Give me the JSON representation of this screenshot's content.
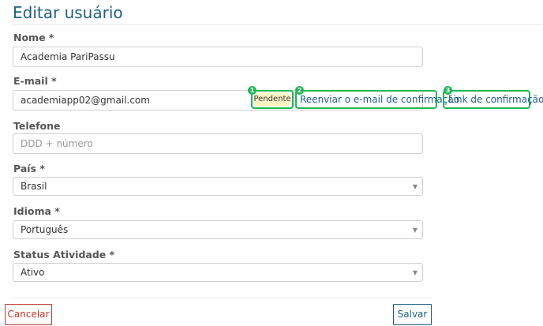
{
  "page": {
    "title": "Editar usuário"
  },
  "form": {
    "name": {
      "label": "Nome *",
      "value": "Academia PariPassu"
    },
    "email": {
      "label": "E-mail *",
      "value": "academiapp02@gmail.com",
      "status_badge": "Pendente",
      "resend_link": "Reenviar o e-mail de confirmação",
      "confirm_link": "Link de confirmação"
    },
    "phone": {
      "label": "Telefone",
      "value": "",
      "placeholder": "DDD + número"
    },
    "country": {
      "label": "País *",
      "selected": "Brasil"
    },
    "language": {
      "label": "Idioma *",
      "selected": "Português"
    },
    "activity_status": {
      "label": "Status Atividade *",
      "selected": "Ativo"
    }
  },
  "annotations": [
    "1",
    "2",
    "3"
  ],
  "actions": {
    "cancel_label": "Cancelar",
    "save_label": "Salvar"
  },
  "colors": {
    "accent": "#1d5f86",
    "highlight": "#1db954",
    "badge_bg": "#fff3c4",
    "cancel": "#c0392b"
  }
}
